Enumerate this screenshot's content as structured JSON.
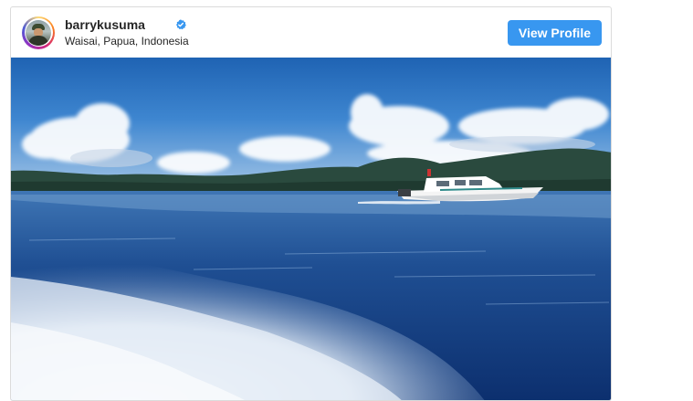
{
  "header": {
    "username": "barrykusuma",
    "location": "Waisai, Papua, Indonesia",
    "verified": true,
    "view_profile_label": "View Profile"
  },
  "post": {
    "image_subject": "speedboat-on-sea-photo"
  },
  "colors": {
    "button_blue": "#3897f0",
    "verified_blue": "#3897f0",
    "text_dark": "#262626",
    "card_border": "#dbdbdb"
  }
}
